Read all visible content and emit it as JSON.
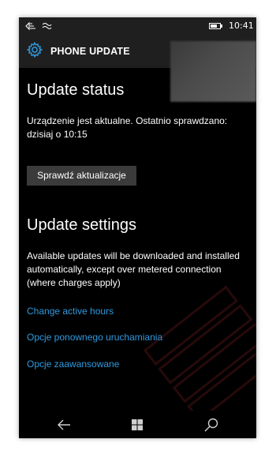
{
  "status_bar": {
    "signal_icon": "sim-signal-icon",
    "wifi_icon": "data-arrows-icon",
    "battery_icon": "battery-icon",
    "battery_level": 0.75,
    "time": "10:41"
  },
  "header": {
    "icon": "gear-icon",
    "title": "PHONE UPDATE"
  },
  "update_status": {
    "title": "Update status",
    "message": "Urządzenie jest aktualne. Ostatnio sprawdzano: dzisiaj o 10:15",
    "check_button_label": "Sprawdź aktualizacje"
  },
  "update_settings": {
    "title": "Update settings",
    "description": "Available updates will be downloaded and installed automatically, except over metered connection (where charges apply)",
    "links": [
      {
        "label": "Change active hours"
      },
      {
        "label": "Opcje ponownego uruchamiania"
      },
      {
        "label": "Opcje zaawansowane"
      }
    ]
  },
  "colors": {
    "background": "#000000",
    "link": "#2f9ae0",
    "accent_icon": "#2f9ae0",
    "button": "#3b3b3b"
  },
  "nav_bar": {
    "back_icon": "back-arrow-icon",
    "home_icon": "windows-logo-icon",
    "search_icon": "search-icon"
  }
}
